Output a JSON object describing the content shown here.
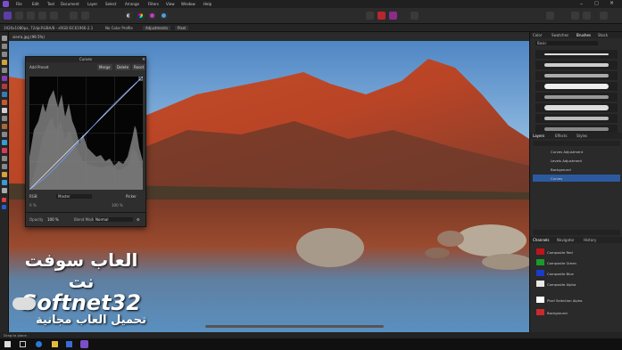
{
  "menubar": {
    "items": [
      "File",
      "Edit",
      "Text",
      "Document",
      "Layer",
      "Select",
      "Arrange",
      "Filters",
      "View",
      "Window",
      "Help"
    ]
  },
  "context": {
    "items": [
      "1920x1080px, 72dpi",
      "RGBA/8 - sRGB IEC61966-2.1",
      "No Color Profile",
      "Adjustments",
      "Pixel"
    ]
  },
  "doc_tab": "sierra.jpg (99.5%)",
  "curves": {
    "title": "Curves",
    "add_preset": "Add Preset",
    "merge": "Merge",
    "delete": "Delete",
    "reset": "Reset",
    "channel_value": "Master",
    "picker_label": "Picker",
    "opacity_label": "Opacity",
    "opacity_value": "100 %",
    "blend_label": "Blend Mode",
    "blend_value": "Normal"
  },
  "panels": {
    "top_tabs": [
      "Color",
      "Swatches",
      "Brushes",
      "Stock"
    ],
    "brush_category": "Basic",
    "layer_tabs": [
      "Layers",
      "Effects",
      "Styles"
    ],
    "layers": [
      {
        "name": "Curves Adjustment",
        "selected": false
      },
      {
        "name": "Levels Adjustment",
        "selected": false
      },
      {
        "name": "Background",
        "selected": false
      },
      {
        "name": "Curves",
        "selected": true
      }
    ],
    "channel_tabs": [
      "Channels",
      "Navigator",
      "History"
    ],
    "channels": [
      {
        "name": "Composite Red",
        "color": "#c0141a"
      },
      {
        "name": "Composite Green",
        "color": "#1a9a2a"
      },
      {
        "name": "Composite Blue",
        "color": "#1a3cc8"
      },
      {
        "name": "Composite Alpha",
        "color": "#e8e8e8"
      },
      {
        "name": "Pixel Selection Alpha",
        "color": "#ffffff"
      },
      {
        "name": "Background",
        "color": "#cc2a2a"
      }
    ]
  },
  "status": "Drag to place.",
  "watermark": {
    "line1": "العاب سوفت نت",
    "line2": "Softnet32",
    "line3": "تحميل العاب مجانية"
  },
  "colors": {
    "accent": "#7b4fc9",
    "panel": "#2a2a2a"
  }
}
